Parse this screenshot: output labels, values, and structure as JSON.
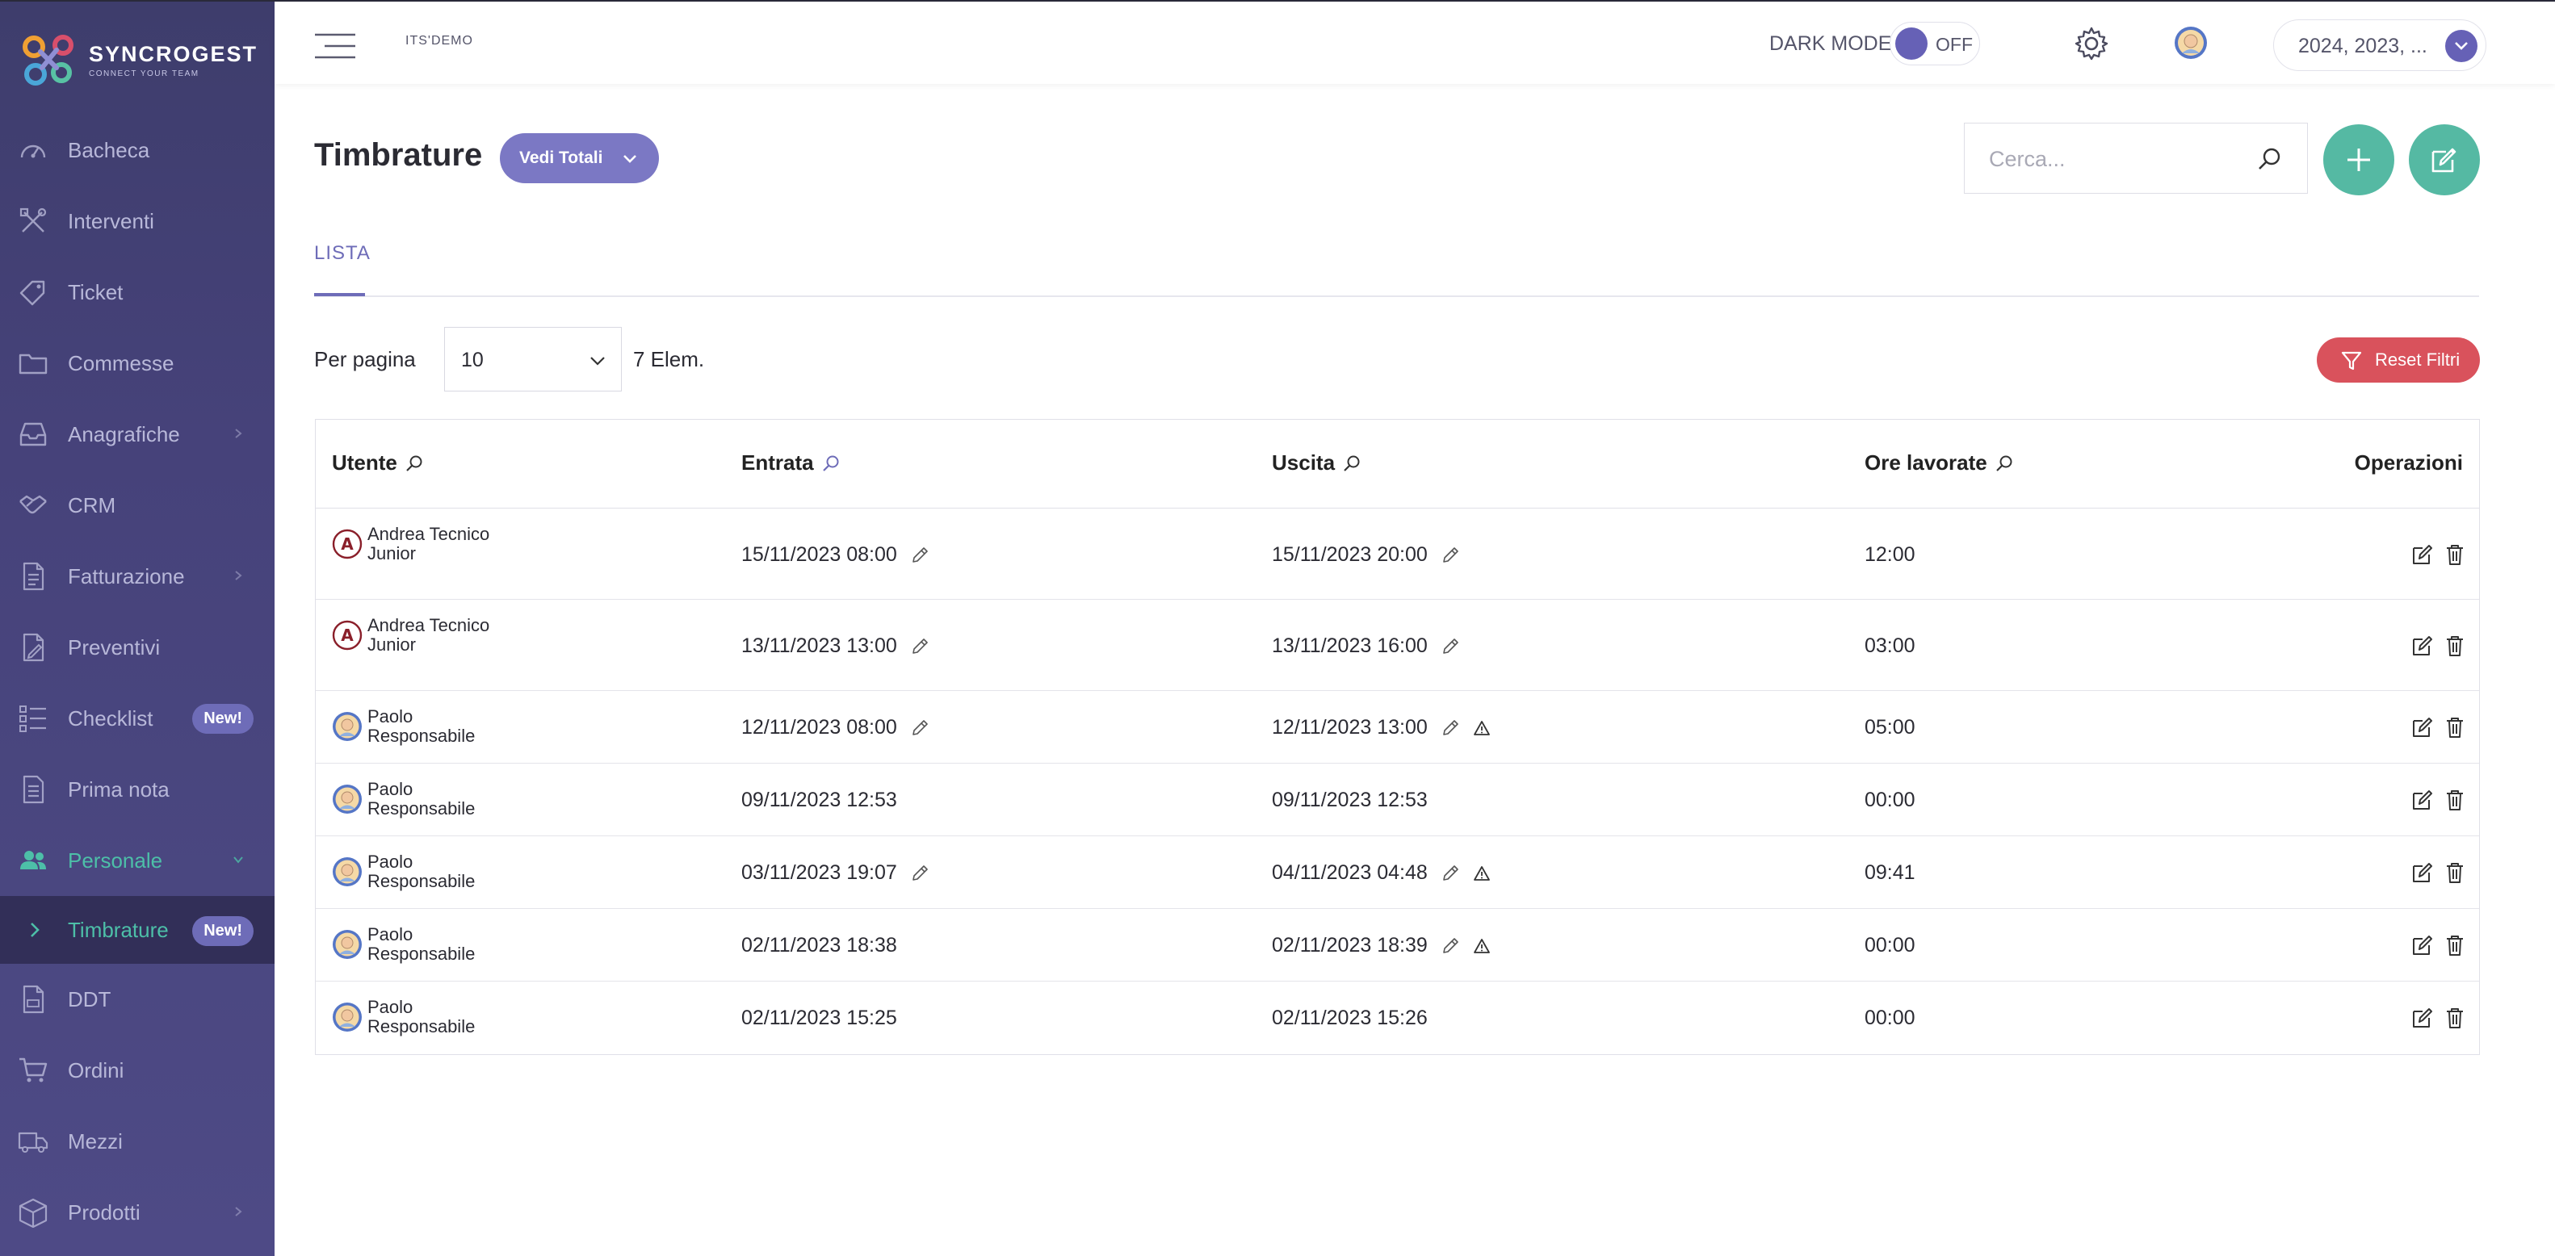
{
  "brand": {
    "name": "SYNCROGEST",
    "tagline": "CONNECT YOUR TEAM"
  },
  "sidebar": {
    "items": [
      {
        "label": "Bacheca",
        "icon": "dashboard-icon"
      },
      {
        "label": "Interventi",
        "icon": "tools-icon"
      },
      {
        "label": "Ticket",
        "icon": "ticket-icon"
      },
      {
        "label": "Commesse",
        "icon": "folder-icon"
      },
      {
        "label": "Anagrafiche",
        "icon": "inbox-icon",
        "has_children": true
      },
      {
        "label": "CRM",
        "icon": "handshake-icon"
      },
      {
        "label": "Fatturazione",
        "icon": "invoice-icon",
        "has_children": true
      },
      {
        "label": "Preventivi",
        "icon": "quote-icon"
      },
      {
        "label": "Checklist",
        "icon": "checklist-icon",
        "badge": "New!"
      },
      {
        "label": "Prima nota",
        "icon": "note-icon"
      },
      {
        "label": "Personale",
        "icon": "users-icon",
        "active": true,
        "expanded": true
      },
      {
        "label": "DDT",
        "icon": "ddt-icon"
      },
      {
        "label": "Ordini",
        "icon": "cart-icon"
      },
      {
        "label": "Mezzi",
        "icon": "truck-icon"
      },
      {
        "label": "Prodotti",
        "icon": "box-icon",
        "has_children": true
      }
    ],
    "subitem": {
      "label": "Timbrature",
      "badge": "New!"
    }
  },
  "topbar": {
    "company": "ITS'DEMO",
    "dark_mode_label": "DARK MODE",
    "dark_mode_state": "OFF",
    "year_select": "2024, 2023, ..."
  },
  "page": {
    "title": "Timbrature",
    "totals_button": "Vedi Totali",
    "search_placeholder": "Cerca...",
    "tab": "LISTA",
    "per_page_label": "Per pagina",
    "per_page_value": "10",
    "elem_count": "7 Elem.",
    "reset_button": "Reset Filtri"
  },
  "table": {
    "headers": {
      "user": "Utente",
      "entry": "Entrata",
      "exit": "Uscita",
      "hours": "Ore lavorate",
      "ops": "Operazioni"
    },
    "rows": [
      {
        "user": "Andrea Tecnico Junior",
        "avatar": "initial",
        "initial": "A",
        "entry": "15/11/2023 08:00",
        "entry_manual": true,
        "exit": "15/11/2023 20:00",
        "exit_manual": true,
        "exit_warning": false,
        "hours": "12:00"
      },
      {
        "user": "Andrea Tecnico Junior",
        "avatar": "initial",
        "initial": "A",
        "entry": "13/11/2023 13:00",
        "entry_manual": true,
        "exit": "13/11/2023 16:00",
        "exit_manual": true,
        "exit_warning": false,
        "hours": "03:00"
      },
      {
        "user": "Paolo Responsabile",
        "avatar": "photo",
        "entry": "12/11/2023 08:00",
        "entry_manual": true,
        "exit": "12/11/2023 13:00",
        "exit_manual": true,
        "exit_warning": true,
        "hours": "05:00"
      },
      {
        "user": "Paolo Responsabile",
        "avatar": "photo",
        "entry": "09/11/2023 12:53",
        "entry_manual": false,
        "exit": "09/11/2023 12:53",
        "exit_manual": false,
        "exit_warning": false,
        "hours": "00:00"
      },
      {
        "user": "Paolo Responsabile",
        "avatar": "photo",
        "entry": "03/11/2023 19:07",
        "entry_manual": true,
        "exit": "04/11/2023 04:48",
        "exit_manual": true,
        "exit_warning": true,
        "hours": "09:41"
      },
      {
        "user": "Paolo Responsabile",
        "avatar": "photo",
        "entry": "02/11/2023 18:38",
        "entry_manual": false,
        "exit": "02/11/2023 18:39",
        "exit_manual": true,
        "exit_warning": true,
        "hours": "00:00"
      },
      {
        "user": "Paolo Responsabile",
        "avatar": "photo",
        "entry": "02/11/2023 15:25",
        "entry_manual": false,
        "exit": "02/11/2023 15:26",
        "exit_manual": false,
        "exit_warning": false,
        "hours": "00:00"
      }
    ]
  },
  "colors": {
    "sidebar_bg": "#46427a",
    "accent_purple": "#6e6cb8",
    "accent_teal": "#55b9a3",
    "danger": "#d9525c"
  }
}
